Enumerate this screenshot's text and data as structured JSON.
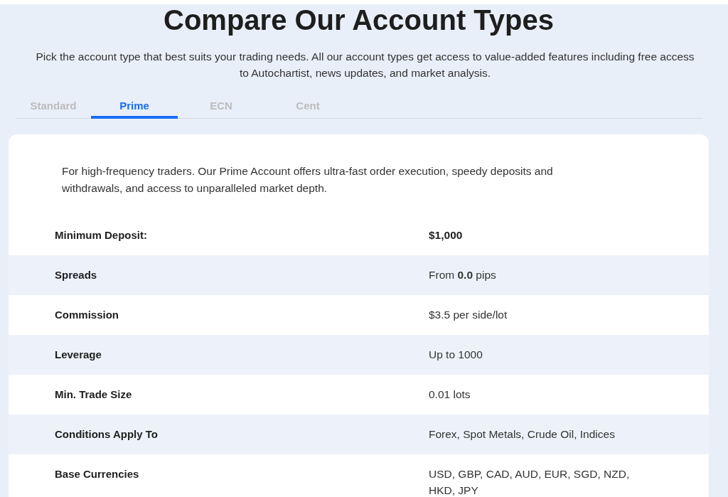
{
  "title": "Compare Our Account Types",
  "subtitle": "Pick the account type that best suits your trading needs. All our account types get access to value-added features including free access to Autochartist, news updates, and market analysis.",
  "tabs": [
    {
      "label": "Standard",
      "selected": false
    },
    {
      "label": "Prime",
      "selected": true
    },
    {
      "label": "ECN",
      "selected": false
    },
    {
      "label": "Cent",
      "selected": false
    }
  ],
  "card": {
    "description": "For high-frequency traders. Our Prime Account offers ultra-fast order execution, speedy deposits and withdrawals, and access to unparalleled market depth.",
    "rows": [
      {
        "label": "Minimum Deposit:",
        "value": "$1,000",
        "strong": true
      },
      {
        "label": "Spreads",
        "value": "From **0.0** pips",
        "strong": false
      },
      {
        "label": "Commission",
        "value": "$3.5 per side/lot",
        "strong": false
      },
      {
        "label": "Leverage",
        "value": "Up to 1000",
        "strong": false
      },
      {
        "label": "Min. Trade Size",
        "value": "0.01 lots",
        "strong": false
      },
      {
        "label": "Conditions Apply To",
        "value": "Forex, Spot Metals, Crude Oil, Indices",
        "strong": false
      },
      {
        "label": "Base Currencies",
        "value": "USD, GBP, CAD, AUD, EUR, SGD, NZD, HKD, JPY",
        "strong": false
      }
    ]
  }
}
